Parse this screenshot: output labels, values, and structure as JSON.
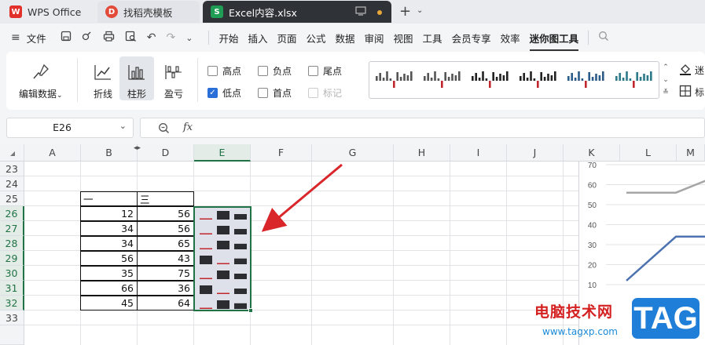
{
  "tabs": [
    {
      "label": "WPS Office",
      "icon": "wps-logo-icon"
    },
    {
      "label": "找稻壳模板",
      "icon": "docer-logo-icon"
    },
    {
      "label": "Excel内容.xlsx",
      "icon": "spreadsheet-s-icon",
      "icon_text": "S",
      "active": true
    }
  ],
  "menu": {
    "file": "文件",
    "items": [
      "开始",
      "插入",
      "页面",
      "公式",
      "数据",
      "审阅",
      "视图",
      "工具",
      "会员专享",
      "效率"
    ],
    "active": "迷你图工具"
  },
  "ribbon": {
    "edit_data": "编辑数据",
    "types": [
      {
        "label": "折线",
        "icon": "line-sparkline-icon"
      },
      {
        "label": "柱形",
        "icon": "column-sparkline-icon",
        "selected": true
      },
      {
        "label": "盈亏",
        "icon": "winloss-sparkline-icon"
      }
    ],
    "checks": [
      {
        "label": "高点",
        "checked": false,
        "disabled": false
      },
      {
        "label": "负点",
        "checked": false,
        "disabled": false
      },
      {
        "label": "尾点",
        "checked": false,
        "disabled": false
      },
      {
        "label": "低点",
        "checked": true,
        "disabled": false
      },
      {
        "label": "首点",
        "checked": false,
        "disabled": false
      },
      {
        "label": "标记",
        "checked": false,
        "disabled": true
      }
    ],
    "right_top": "迷",
    "right_bottom": "标",
    "style_colors": [
      "#555555",
      "#555555",
      "#222222",
      "#222222",
      "#2c5d8a",
      "#2c7a8a"
    ],
    "style_accent": "#c0282d"
  },
  "formula": {
    "name_box": "E26",
    "fx": "fx",
    "content": ""
  },
  "columns": [
    "A",
    "B",
    "D",
    "E",
    "F",
    "G",
    "H",
    "I",
    "J",
    "K",
    "L",
    "M"
  ],
  "rows": [
    "23",
    "24",
    "25",
    "26",
    "27",
    "28",
    "29",
    "30",
    "31",
    "32",
    "33"
  ],
  "table": {
    "headers": [
      "一",
      "三"
    ],
    "rows": [
      [
        12,
        56
      ],
      [
        34,
        56
      ],
      [
        34,
        65
      ],
      [
        56,
        43
      ],
      [
        35,
        75
      ],
      [
        66,
        36
      ],
      [
        45,
        64
      ]
    ]
  },
  "sparkline": {
    "color": "#2b2d30",
    "low_color": "#c0282d"
  },
  "chart_data": {
    "type": "line",
    "y_ticks": [
      70,
      60,
      50,
      40,
      30,
      20,
      10
    ],
    "series": [
      {
        "color": "#a6a6a6"
      },
      {
        "color": "#4c73b0"
      }
    ]
  },
  "watermark": {
    "text": "电脑技术网",
    "url": "www.tagxp.com",
    "tag": "TAG"
  },
  "accent": "#217346"
}
